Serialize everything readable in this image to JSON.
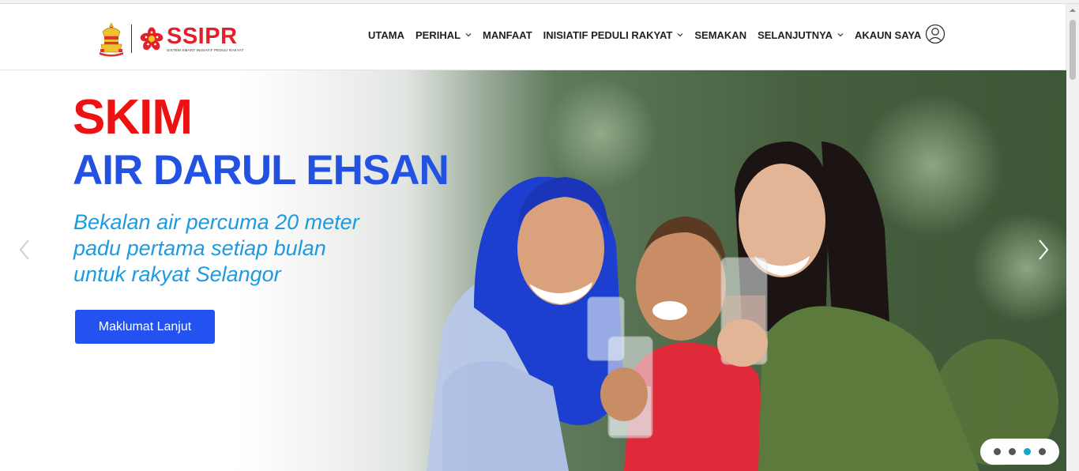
{
  "header": {
    "brand": "SSIPR",
    "brand_tagline": "SISTEM SMART INISIATIF PEDULI RAKYAT",
    "menu": [
      {
        "label": "UTAMA",
        "dropdown": false
      },
      {
        "label": "PERIHAL",
        "dropdown": true
      },
      {
        "label": "MANFAAT",
        "dropdown": false
      },
      {
        "label": "INISIATIF PEDULI RAKYAT",
        "dropdown": true
      },
      {
        "label": "SEMAKAN",
        "dropdown": false
      },
      {
        "label": "SELANJUTNYA",
        "dropdown": true
      },
      {
        "label": "AKAUN SAYA",
        "dropdown": false
      }
    ]
  },
  "hero": {
    "title_line1": "SKIM",
    "title_line2": "AIR DARUL EHSAN",
    "subtitle_lines": [
      "Bekalan air percuma 20 meter",
      "padu pertama setiap bulan",
      "untuk rakyat Selangor"
    ],
    "cta_label": "Maklumat Lanjut",
    "slide_count": 4,
    "active_slide": 3
  },
  "colors": {
    "title_red": "#ee1111",
    "title_blue": "#2352e2",
    "subtitle_blue": "#1e9ae0",
    "button_blue": "#2352f0",
    "brand_red": "#e3202a",
    "active_dot": "#1aa4c6"
  },
  "icons": {
    "crest": "selangor-crest-icon",
    "flower": "ssipr-flower-icon",
    "user": "user-circle-icon",
    "prev": "chevron-left-icon",
    "next": "chevron-right-icon"
  }
}
